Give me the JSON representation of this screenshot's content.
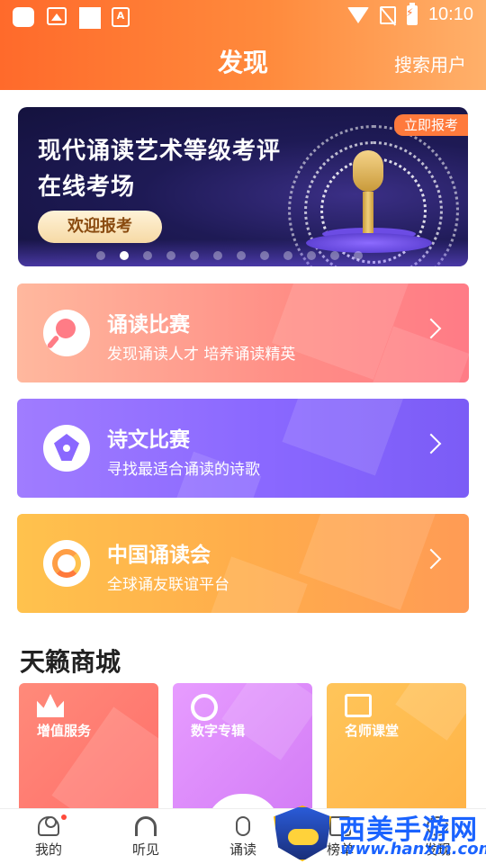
{
  "status_bar": {
    "time": "10:10"
  },
  "header": {
    "title": "发现",
    "search_users": "搜索用户"
  },
  "banner": {
    "title_line1": "现代诵读艺术等级考评",
    "title_line2": "在线考场",
    "button": "欢迎报考",
    "tag": "立即报考",
    "carousel": {
      "total": 12,
      "active_index": 1
    }
  },
  "features": [
    {
      "title": "诵读比赛",
      "subtitle": "发现诵读人才  培养诵读精英",
      "icon": "microphone-icon"
    },
    {
      "title": "诗文比赛",
      "subtitle": "寻找最适合诵读的诗歌",
      "icon": "pen-nib-icon"
    },
    {
      "title": "中国诵读会",
      "subtitle": "全球诵友联谊平台",
      "icon": "association-logo-icon"
    }
  ],
  "shop": {
    "title": "天籁商城",
    "items": [
      {
        "label": "增值服务",
        "icon": "crown-icon",
        "color": "#ff7a70"
      },
      {
        "label": "数字专辑",
        "icon": "disc-icon",
        "color": "#dd8cfa"
      },
      {
        "label": "名师课堂",
        "icon": "tv-icon",
        "color": "#ffbb50"
      }
    ]
  },
  "bottom_nav": [
    {
      "label": "我的",
      "icon": "person-icon"
    },
    {
      "label": "听见",
      "icon": "headphones-icon"
    },
    {
      "label": "诵读",
      "icon": "microphone-icon"
    },
    {
      "label": "榜单",
      "icon": "ranking-icon"
    },
    {
      "label": "发现",
      "icon": "discover-icon"
    }
  ],
  "watermark": {
    "text": "西美手游网",
    "url": "www.hanxm.com"
  },
  "colors": {
    "accent": "#ff7a32",
    "card1": "#ff8e86",
    "card2": "#8a68ff",
    "card3": "#ffad4b"
  }
}
